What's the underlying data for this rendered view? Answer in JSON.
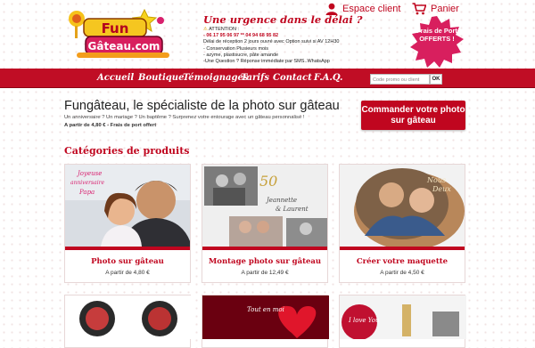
{
  "header": {
    "logo_text_top": "Fun",
    "logo_text_bottom": "Gâteau.com",
    "account_label": "Espace client",
    "cart_label": "Panier",
    "urgency": {
      "title": "Une urgence dans le délai ?",
      "lines": [
        "ATTENTION :",
        "- 06 17 95 06 97 ** 04 94 68 95 82",
        "Délai de réception 2 jours ouvré avec Option suivi si AV 12H30",
        "- Conservation Plusieurs mois",
        "- azyme, plastisucre, pâte amande",
        "-Une Question ? Réponse immédiate par SMS..WhatsApp"
      ]
    },
    "badge": "Frais de Port OFFERTS !"
  },
  "nav": {
    "items": [
      "Accueil",
      "Boutique",
      "Témoignages",
      "Tarifs",
      "Contact",
      "F.A.Q."
    ],
    "promo_placeholder": "Code promo ou client",
    "promo_button": "OK"
  },
  "intro": {
    "title": "Fungâteau, le spécialiste de la photo sur gâteau",
    "subtitle": "Un anniversaire ? Un mariage ? Un baptême ? Surprenez votre entourage avec un gâteau personnalisé !",
    "price_note": "A partir de 4,80 € - Frais de port offert",
    "cta": "Commander votre photo sur gâteau"
  },
  "categories": {
    "title": "Catégories de produits",
    "cards": [
      {
        "title": "Photo sur gâteau",
        "price": "A partir de 4,80 €",
        "overlay_lines": [
          "Joyeuse",
          "anniversaire",
          "Papa"
        ]
      },
      {
        "title": "Montage photo sur gâteau",
        "price": "A partir de 12,49 €",
        "overlay_lines": [
          "50",
          "Jeannette",
          "& Laurent"
        ]
      },
      {
        "title": "Créer votre maquette",
        "price": "A partir de 4,50 €",
        "overlay_lines": [
          "Nous",
          "Deux"
        ]
      }
    ],
    "row2_overlays": [
      "Tout en moi",
      "I love You"
    ]
  },
  "colors": {
    "brand_red": "#c0061f",
    "nav_red": "#c00d25"
  }
}
